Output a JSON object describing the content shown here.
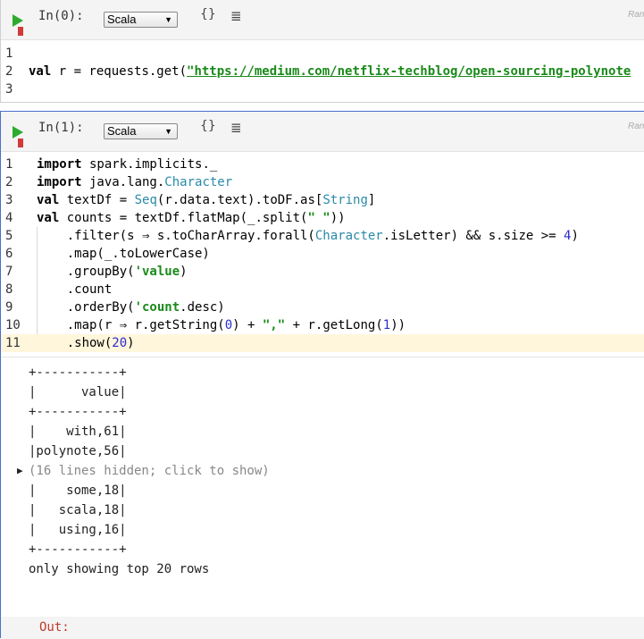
{
  "cells": [
    {
      "prompt": "In(0):",
      "language": "Scala",
      "braces_label": "{}",
      "lines_icon_glyph": "≣",
      "ran_label": "Ran",
      "code_lines": [
        {
          "n": "1",
          "segs": []
        },
        {
          "n": "2",
          "segs": [
            {
              "t": "val",
              "c": "kw"
            },
            {
              "t": " r = requests.get(",
              "c": ""
            },
            {
              "t": "\"https://medium.com/netflix-techblog/open-sourcing-polynote",
              "c": "url"
            }
          ]
        },
        {
          "n": "3",
          "segs": []
        }
      ]
    },
    {
      "prompt": "In(1):",
      "language": "Scala",
      "braces_label": "{}",
      "lines_icon_glyph": "≣",
      "ran_label": "Ran",
      "code_lines": [
        {
          "n": "1",
          "segs": [
            {
              "t": "import",
              "c": "kw"
            },
            {
              "t": " spark.implicits._",
              "c": ""
            }
          ]
        },
        {
          "n": "2",
          "segs": [
            {
              "t": "import",
              "c": "kw"
            },
            {
              "t": " java.lang.",
              "c": ""
            },
            {
              "t": "Character",
              "c": "ty"
            }
          ]
        },
        {
          "n": "3",
          "segs": [
            {
              "t": "val",
              "c": "kw"
            },
            {
              "t": " textDf = ",
              "c": ""
            },
            {
              "t": "Seq",
              "c": "ty"
            },
            {
              "t": "(r.data.text).toDF.as[",
              "c": ""
            },
            {
              "t": "String",
              "c": "ty"
            },
            {
              "t": "]",
              "c": ""
            }
          ]
        },
        {
          "n": "4",
          "segs": [
            {
              "t": "val",
              "c": "kw"
            },
            {
              "t": " counts = textDf.flatMap(_.split(",
              "c": ""
            },
            {
              "t": "\" \"",
              "c": "str"
            },
            {
              "t": "))",
              "c": ""
            }
          ]
        },
        {
          "n": "5",
          "segs": [
            {
              "t": "    .filter(s ⇒ s.toCharArray.forall(",
              "c": ""
            },
            {
              "t": "Character",
              "c": "ty"
            },
            {
              "t": ".isLetter) && s.size >= ",
              "c": ""
            },
            {
              "t": "4",
              "c": "num"
            },
            {
              "t": ")",
              "c": ""
            }
          ]
        },
        {
          "n": "6",
          "segs": [
            {
              "t": "    .map(_.toLowerCase)",
              "c": ""
            }
          ]
        },
        {
          "n": "7",
          "segs": [
            {
              "t": "    .groupBy(",
              "c": ""
            },
            {
              "t": "'value",
              "c": "str"
            },
            {
              "t": ")",
              "c": ""
            }
          ]
        },
        {
          "n": "8",
          "segs": [
            {
              "t": "    .count",
              "c": ""
            }
          ]
        },
        {
          "n": "9",
          "segs": [
            {
              "t": "    .orderBy(",
              "c": ""
            },
            {
              "t": "'count",
              "c": "str"
            },
            {
              "t": ".desc)",
              "c": ""
            }
          ]
        },
        {
          "n": "10",
          "segs": [
            {
              "t": "    .map(r ⇒ r.getString(",
              "c": ""
            },
            {
              "t": "0",
              "c": "num"
            },
            {
              "t": ") + ",
              "c": ""
            },
            {
              "t": "\",\"",
              "c": "str"
            },
            {
              "t": " + r.getLong(",
              "c": ""
            },
            {
              "t": "1",
              "c": "num"
            },
            {
              "t": "))",
              "c": ""
            }
          ]
        },
        {
          "n": "11",
          "segs": [
            {
              "t": "    .show(",
              "c": ""
            },
            {
              "t": "20",
              "c": "num"
            },
            {
              "t": ")",
              "c": ""
            }
          ]
        }
      ],
      "output_lines": [
        {
          "t": "+-----------+"
        },
        {
          "t": "|      value|"
        },
        {
          "t": "+-----------+"
        },
        {
          "t": "|    with,61|"
        },
        {
          "t": "|polynote,56|"
        },
        {
          "t": "(16 lines hidden; click to show)",
          "hidden": true,
          "arrow": "▶"
        },
        {
          "t": "|    some,18|"
        },
        {
          "t": "|   scala,18|"
        },
        {
          "t": "|   using,16|"
        },
        {
          "t": "+-----------+"
        },
        {
          "t": "only showing top 20 rows"
        }
      ],
      "out_label": "Out:"
    }
  ]
}
